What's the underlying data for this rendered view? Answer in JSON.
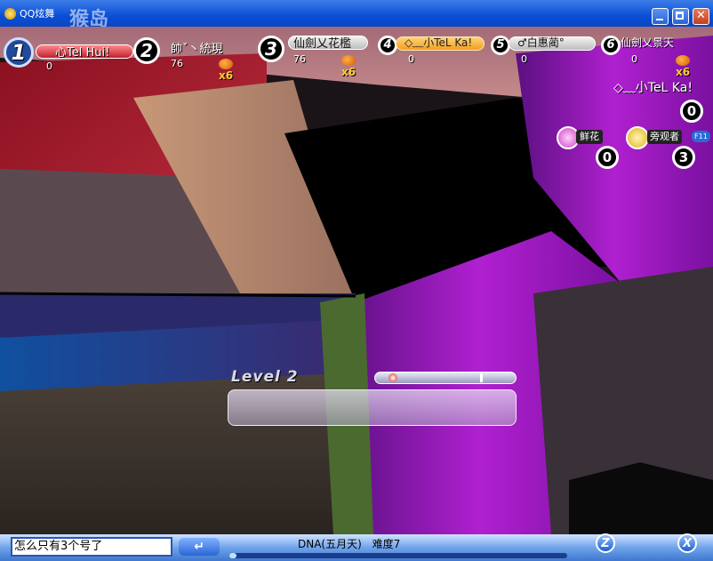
{
  "window": {
    "title": "QQ炫舞",
    "watermark": "猴岛",
    "controls": [
      "minimize-icon",
      "maximize-icon",
      "close-icon"
    ]
  },
  "players": [
    {
      "slot": "1",
      "name": "心Tel Hui!",
      "score": "0",
      "combo": ""
    },
    {
      "slot": "2",
      "name": "帥ˇ丶統現",
      "score": "76",
      "combo": "x6"
    },
    {
      "slot": "3",
      "name": "仙劍乂花檻",
      "score": "76",
      "combo": "x6"
    },
    {
      "slot": "4",
      "name": "◇﹏小TeL Ka!",
      "score": "0",
      "combo": ""
    },
    {
      "slot": "5",
      "name": "♂白惠蔺°",
      "score": "0",
      "combo": ""
    },
    {
      "slot": "6",
      "name": "仙劍乂景天",
      "score": "0",
      "combo": "x6"
    }
  ],
  "self_panel": {
    "name": "◇﹏小TeL Ka!",
    "score": "0",
    "flowers_label": "鲜花",
    "flowers_count": "0",
    "spectators_label": "旁观者",
    "spectators_key": "F11",
    "spectators_count": "3"
  },
  "level": {
    "label": "Level 2",
    "progress": 0.02
  },
  "chat": {
    "input_value": "怎么只有3个号了",
    "enter_label": "↵"
  },
  "song": {
    "title": "DNA(五月天)",
    "difficulty": "难度7",
    "progress": 0.02
  },
  "hotkeys": {
    "z": "Z",
    "x": "X"
  },
  "colors": {
    "titlebar": "#0a4ed6",
    "accent_orange": "#f5a623",
    "magenta_stage": "#b01fd0",
    "bottombar": "#6fa3ea"
  }
}
